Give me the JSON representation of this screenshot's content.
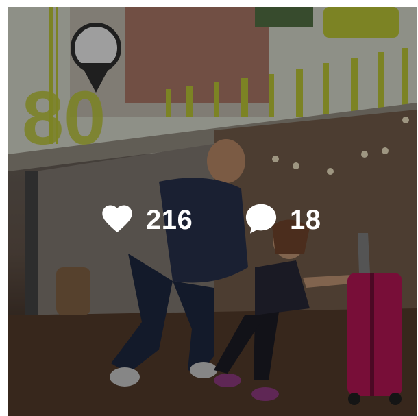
{
  "post": {
    "likes_count": "216",
    "comments_count": "18",
    "icons": {
      "likes": "heart-icon",
      "comments": "comment-bubble-icon"
    },
    "colors": {
      "overlay_text": "#ffffff",
      "suitcase": "#c2185b",
      "signage": "#c8d43a"
    }
  }
}
